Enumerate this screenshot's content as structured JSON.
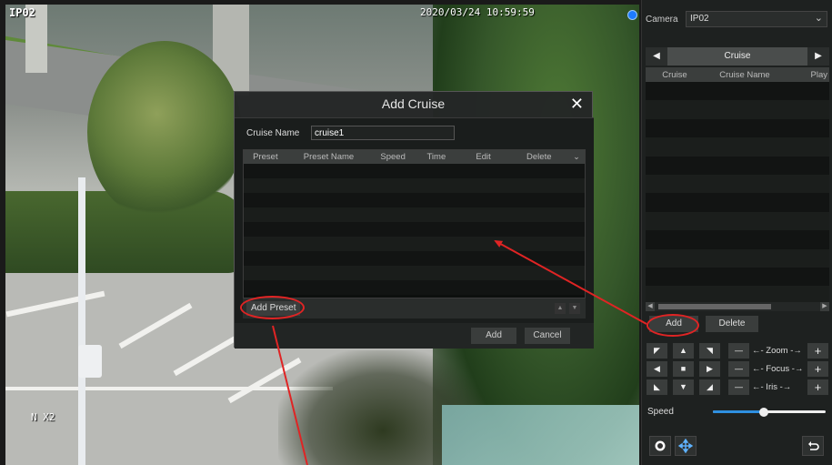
{
  "video": {
    "camera_osd": "IP02",
    "timestamp": "2020/03/24 10:59:59",
    "zoom_osd": "N X2"
  },
  "dialog": {
    "title": "Add Cruise",
    "close_glyph": "✕",
    "cruise_name_label": "Cruise Name",
    "cruise_name_value": "cruise1",
    "table_headers": [
      "Preset",
      "Preset Name",
      "Speed",
      "Time",
      "Edit",
      "Delete"
    ],
    "add_preset_label": "Add Preset",
    "add_label": "Add",
    "cancel_label": "Cancel"
  },
  "panel": {
    "camera_label": "Camera",
    "camera_value": "IP02",
    "tab_label": "Cruise",
    "prev_glyph": "◀",
    "next_glyph": "▶",
    "table_headers": [
      "Cruise",
      "Cruise Name",
      "Play"
    ],
    "add_label": "Add",
    "delete_label": "Delete",
    "zoom_label": "←- Zoom -→",
    "focus_label": "←- Focus -→",
    "iris_label": "←-  Iris  -→",
    "speed_label": "Speed",
    "speed_level": 0.45
  },
  "icons": {
    "plus": "+",
    "minus": "—",
    "stop": "■"
  },
  "colors": {
    "annotation": "#e02424",
    "record_indicator": "#1e7bff"
  }
}
